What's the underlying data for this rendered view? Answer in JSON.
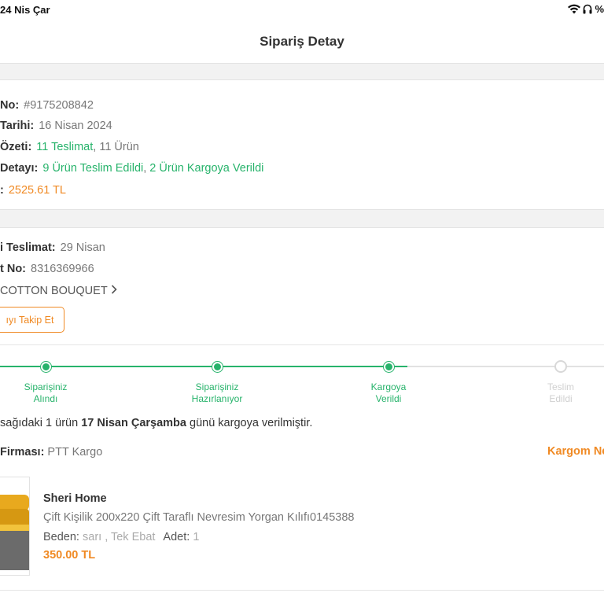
{
  "status_bar": {
    "time": "24 Nis Çar",
    "battery": "%"
  },
  "header": {
    "title": "Sipariş Detay"
  },
  "order": {
    "no_label": "No:",
    "no_value": "#9175208842",
    "date_label": "Tarihi:",
    "date_value": "16 Nisan 2024",
    "summary_label": "Özeti:",
    "summary_deliveries": "11 Teslimat",
    "summary_items": ", 11 Ürün",
    "detail_label": "Detayı:",
    "detail_delivered": "9 Ürün Teslim Edildi",
    "detail_sep": ", ",
    "detail_shipped": "2 Ürün Kargoya Verildi",
    "total_label": ":",
    "total_value": "2525.61 TL"
  },
  "delivery": {
    "est_label": "i Teslimat:",
    "est_value": "29 Nisan",
    "no_label": "t No:",
    "no_value": "8316369966",
    "seller": "COTTON BOUQUET",
    "track_button": "ıyı Takip Et"
  },
  "progress": {
    "steps": [
      {
        "label_line1": "Siparişiniz",
        "label_line2": "Alındı",
        "state": "done"
      },
      {
        "label_line1": "Siparişiniz",
        "label_line2": "Hazırlanıyor",
        "state": "done"
      },
      {
        "label_line1": "Kargoya",
        "label_line2": "Verildi",
        "state": "done"
      },
      {
        "label_line1": "Teslim",
        "label_line2": "Edildi",
        "state": "todo"
      }
    ],
    "done_color": "#27b36b",
    "todo_color": "#d8d8d8"
  },
  "shipment": {
    "note_prefix": "sağıdaki 1 ürün ",
    "note_date": "17 Nisan Çarşamba",
    "note_suffix": " günü kargoya verilmiştir.",
    "firm_label": "Firması:",
    "firm_value": "PTT Kargo",
    "cargo_link": "Kargom Ne"
  },
  "product": {
    "seller": "Sheri Home",
    "name": "Çift Kişilik 200x220 Çift Taraflı Nevresim Yorgan Kılıfı0145388",
    "size_label": "Beden:",
    "size_value": "sarı , Tek Ebat",
    "qty_label": "Adet:",
    "qty_value": "1",
    "price": "350.00 TL"
  },
  "colors": {
    "accent_orange": "#f08a24",
    "accent_green": "#27b36b"
  }
}
